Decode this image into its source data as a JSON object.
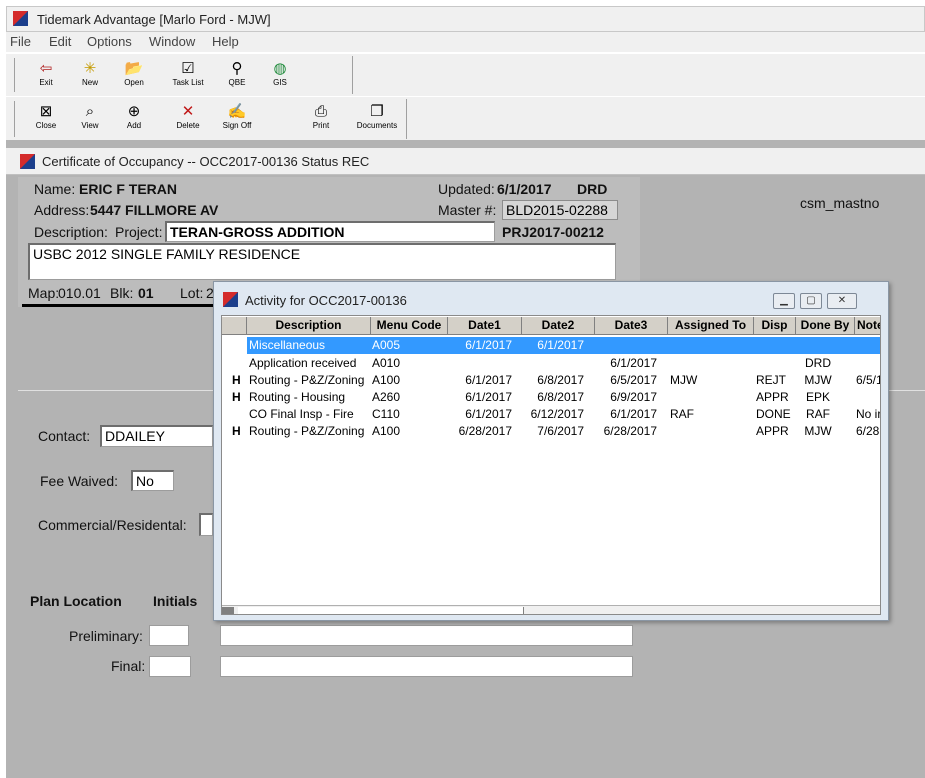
{
  "app": {
    "title": "Tidemark Advantage [Marlo Ford - MJW]"
  },
  "menu": [
    "File",
    "Edit",
    "Options",
    "Window",
    "Help"
  ],
  "toolbar1": [
    {
      "label": "Exit",
      "icon": "exit-icon",
      "glyph": "⇦"
    },
    {
      "label": "New",
      "icon": "new-icon",
      "glyph": "✳"
    },
    {
      "label": "Open",
      "icon": "open-folder-icon",
      "glyph": "📂"
    },
    {
      "label": "Task List",
      "icon": "task-list-icon",
      "glyph": "☑"
    },
    {
      "label": "QBE",
      "icon": "binoculars-icon",
      "glyph": "⚲"
    },
    {
      "label": "GIS",
      "icon": "globe-icon",
      "glyph": "◍"
    }
  ],
  "toolbar2": [
    {
      "label": "Close",
      "icon": "close-icon",
      "glyph": "⊠"
    },
    {
      "label": "View",
      "icon": "view-icon",
      "glyph": "⌕"
    },
    {
      "label": "Add",
      "icon": "add-icon",
      "glyph": "⊕"
    },
    {
      "label": "Delete",
      "icon": "delete-icon",
      "glyph": "✕"
    },
    {
      "label": "Sign Off",
      "icon": "sign-off-icon",
      "glyph": "✍"
    },
    {
      "label": "Print",
      "icon": "printer-icon",
      "glyph": "⎙"
    },
    {
      "label": "Documents",
      "icon": "documents-icon",
      "glyph": "❐"
    }
  ],
  "doc": {
    "title": "Certificate of Occupancy  -- OCC2017-00136    Status REC",
    "name_label": "Name:",
    "name_value": "ERIC F TERAN",
    "address_label": "Address:",
    "address_value": "5447 FILLMORE AV",
    "updated_label": "Updated:",
    "updated_date": "6/1/2017",
    "updated_by": "DRD",
    "master_label": "Master #:",
    "master_value": "BLD2015-02288",
    "csm": "csm_mastno",
    "description_label": "Description:",
    "project_label": "Project:",
    "project_value": "TERAN-GROSS ADDITION",
    "project_number": "PRJ2017-00212",
    "description_text": "USBC 2012 SINGLE FAMILY RESIDENCE",
    "map_label": "Map:",
    "map_value": "010.01",
    "blk_label": "Blk:",
    "blk_value": "01",
    "lot_label": "Lot:",
    "lot_value": "2",
    "contact_label": "Contact:",
    "contact_value": "DDAILEY",
    "fee_waived_label": "Fee Waived:",
    "fee_waived_value": "No",
    "commercial_label": "Commercial/Residental:",
    "plan_location_label": "Plan Location",
    "initials_label": "Initials",
    "preliminary_label": "Preliminary:",
    "final_label": "Final:"
  },
  "activity": {
    "title": "Activity for OCC2017-00136",
    "columns": [
      "Description",
      "Menu Code",
      "Date1",
      "Date2",
      "Date3",
      "Assigned To",
      "Disp",
      "Done By",
      "Note"
    ],
    "rows": [
      {
        "flag": "",
        "description": "Miscellaneous",
        "menu_code": "A005",
        "date1": "6/1/2017",
        "date2": "6/1/2017",
        "date3": "",
        "assigned_to": "",
        "disp": "",
        "done_by": "",
        "note": ""
      },
      {
        "flag": "",
        "description": "Application received",
        "menu_code": "A010",
        "date1": "",
        "date2": "",
        "date3": "6/1/2017",
        "assigned_to": "",
        "disp": "",
        "done_by": "DRD",
        "note": ""
      },
      {
        "flag": "H",
        "description": "Routing - P&Z/Zoning",
        "menu_code": "A100",
        "date1": "6/1/2017",
        "date2": "6/8/2017",
        "date3": "6/5/2017",
        "assigned_to": "MJW",
        "disp": "REJT",
        "done_by": "MJW",
        "note": "6/5/1"
      },
      {
        "flag": "H",
        "description": "Routing - Housing",
        "menu_code": "A260",
        "date1": "6/1/2017",
        "date2": "6/8/2017",
        "date3": "6/9/2017",
        "assigned_to": "",
        "disp": "APPR",
        "done_by": "EPK",
        "note": ""
      },
      {
        "flag": "",
        "description": "CO Final Insp - Fire",
        "menu_code": "C110",
        "date1": "6/1/2017",
        "date2": "6/12/2017",
        "date3": "6/1/2017",
        "assigned_to": "RAF",
        "disp": "DONE",
        "done_by": "RAF",
        "note": "No ir"
      },
      {
        "flag": "H",
        "description": "Routing - P&Z/Zoning",
        "menu_code": "A100",
        "date1": "6/28/2017",
        "date2": "7/6/2017",
        "date3": "6/28/2017",
        "assigned_to": "",
        "disp": "APPR",
        "done_by": "MJW",
        "note": "6/28"
      }
    ]
  },
  "colors": {
    "selected_row": "#3399ff",
    "doc_background": "#b3b3b3",
    "popup_frame": "#dfe8f2"
  }
}
